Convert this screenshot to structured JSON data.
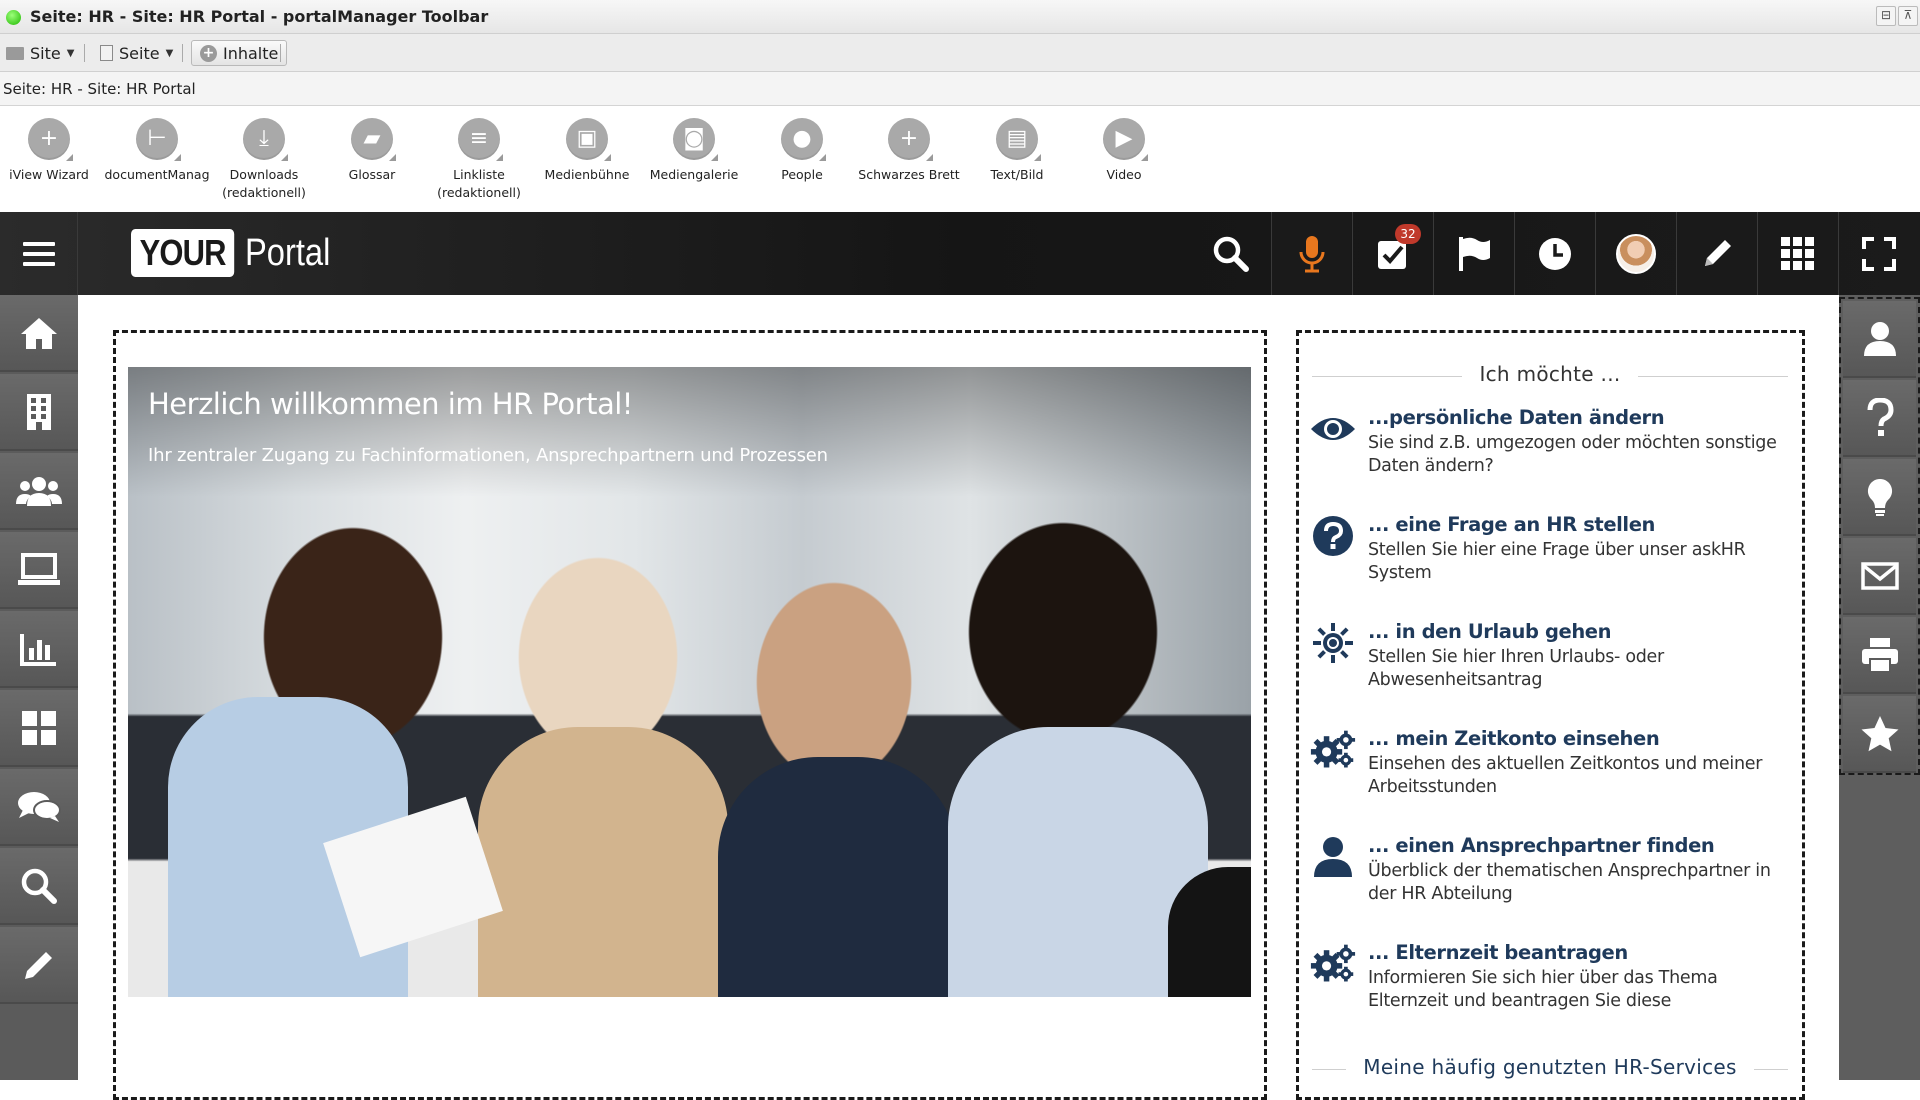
{
  "window": {
    "title": "Seite: HR - Site: HR Portal - portalManager Toolbar",
    "status_color": "#1fb800"
  },
  "menu": {
    "site_label": "Site",
    "page_label": "Seite",
    "content_label": "Inhalte"
  },
  "breadcrumb": "Seite: HR - Site: HR Portal",
  "widgets": [
    {
      "label": "iView Wizard",
      "icon": "plus-icon"
    },
    {
      "label": "documentManag",
      "icon": "document-tree-icon"
    },
    {
      "label": "Downloads (redaktionell)",
      "icon": "download-icon"
    },
    {
      "label": "Glossar",
      "icon": "book-icon"
    },
    {
      "label": "Linkliste (redaktionell)",
      "icon": "list-icon"
    },
    {
      "label": "Medienbühne",
      "icon": "image-stage-icon"
    },
    {
      "label": "Mediengalerie",
      "icon": "camera-icon"
    },
    {
      "label": "People",
      "icon": "person-icon"
    },
    {
      "label": "Schwarzes Brett",
      "icon": "plus-icon"
    },
    {
      "label": "Text/Bild",
      "icon": "text-image-icon"
    },
    {
      "label": "Video",
      "icon": "play-icon"
    }
  ],
  "header": {
    "logo_box": "YOUR",
    "logo_text": "Portal",
    "tasks_badge": "32",
    "accent_mic": "#e8771e",
    "badge_color": "#c0392b"
  },
  "left_nav": [
    "home-icon",
    "building-icon",
    "team-icon",
    "laptop-icon",
    "chart-icon",
    "dashboard-icon",
    "chat-icon",
    "search-icon",
    "edit-icon"
  ],
  "right_nav": [
    "user-icon",
    "help-icon",
    "lightbulb-icon",
    "mail-icon",
    "print-icon",
    "star-icon"
  ],
  "hero": {
    "title": "Herzlich willkommen im HR Portal!",
    "subtitle": "Ihr zentraler Zugang zu Fachinformationen, Ansprechpartnern und Prozessen"
  },
  "sidebar": {
    "heading": "Ich möchte ...",
    "items": [
      {
        "title": "...persönliche Daten ändern",
        "desc": "Sie sind z.B. umgezogen oder möchten sonstige Daten ändern?",
        "icon": "eye-icon"
      },
      {
        "title": "... eine Frage an HR stellen",
        "desc": "Stellen Sie hier eine Frage über unser askHR System",
        "icon": "question-icon"
      },
      {
        "title": "... in den Urlaub gehen",
        "desc": "Stellen Sie hier Ihren Urlaubs- oder Abwesenheitsantrag",
        "icon": "sun-icon"
      },
      {
        "title": "... mein Zeitkonto einsehen",
        "desc": "Einsehen des aktuellen Zeitkontos und meiner Arbeitsstunden",
        "icon": "gears-icon"
      },
      {
        "title": "... einen Ansprechpartner finden",
        "desc": "Überblick der thematischen Ansprechpartner in der HR Abteilung",
        "icon": "person-icon"
      },
      {
        "title": "... Elternzeit beantragen",
        "desc": "Informieren Sie sich hier über das Thema Elternzeit und beantragen Sie diese",
        "icon": "gears-icon"
      }
    ],
    "footer_heading": "Meine häufig genutzten HR-Services",
    "title_color": "#1f3a5b"
  }
}
